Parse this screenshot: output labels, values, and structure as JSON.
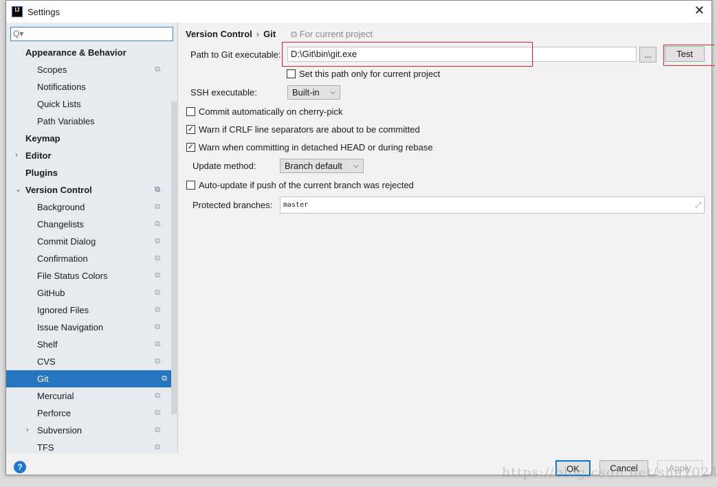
{
  "window": {
    "title": "Settings",
    "logo": "IJ"
  },
  "search": {
    "placeholder": "Q▾"
  },
  "sidebar": {
    "items": [
      {
        "label": "Appearance & Behavior",
        "level": "top"
      },
      {
        "label": "Scopes",
        "level": "sub",
        "project": true
      },
      {
        "label": "Notifications",
        "level": "sub"
      },
      {
        "label": "Quick Lists",
        "level": "sub"
      },
      {
        "label": "Path Variables",
        "level": "sub"
      },
      {
        "label": "Keymap",
        "level": "top"
      },
      {
        "label": "Editor",
        "level": "top",
        "arrow": "›"
      },
      {
        "label": "Plugins",
        "level": "top"
      },
      {
        "label": "Version Control",
        "level": "top",
        "arrow": "⌄",
        "project": true
      },
      {
        "label": "Background",
        "level": "sub",
        "project": true
      },
      {
        "label": "Changelists",
        "level": "sub",
        "project": true
      },
      {
        "label": "Commit Dialog",
        "level": "sub",
        "project": true
      },
      {
        "label": "Confirmation",
        "level": "sub",
        "project": true
      },
      {
        "label": "File Status Colors",
        "level": "sub",
        "project": true
      },
      {
        "label": "GitHub",
        "level": "sub",
        "project": true
      },
      {
        "label": "Ignored Files",
        "level": "sub",
        "project": true
      },
      {
        "label": "Issue Navigation",
        "level": "sub",
        "project": true
      },
      {
        "label": "Shelf",
        "level": "sub",
        "project": true
      },
      {
        "label": "CVS",
        "level": "sub",
        "project": true
      },
      {
        "label": "Git",
        "level": "sub",
        "project": true,
        "selected": true
      },
      {
        "label": "Mercurial",
        "level": "sub",
        "project": true
      },
      {
        "label": "Perforce",
        "level": "sub",
        "project": true
      },
      {
        "label": "Subversion",
        "level": "sub",
        "project": true,
        "arrow": "›"
      },
      {
        "label": "TFS",
        "level": "sub",
        "project": true
      }
    ]
  },
  "breadcrumb": {
    "parent": "Version Control",
    "current": "Git",
    "scope": "For current project"
  },
  "git": {
    "path_label": "Path to Git executable:",
    "path_value": "D:\\Git\\bin\\git.exe",
    "browse_label": "...",
    "test_label": "Test",
    "current_project_only": "Set this path only for current project",
    "ssh_label": "SSH executable:",
    "ssh_value": "Built-in",
    "cherry_pick": "Commit automatically on cherry-pick",
    "crlf": "Warn if CRLF line separators are about to be committed",
    "detached": "Warn when committing in detached HEAD or during rebase",
    "update_label": "Update method:",
    "update_value": "Branch default",
    "autoupdate": "Auto-update if push of the current branch was rejected",
    "protected_label": "Protected branches:",
    "protected_value": "master"
  },
  "checks": {
    "cherry_pick": false,
    "crlf": true,
    "detached": true,
    "autoupdate": false,
    "current_project_only": false
  },
  "footer": {
    "help": "?",
    "ok": "OK",
    "cancel": "Cancel",
    "apply": "Apply"
  },
  "watermark": "https://blog.csdn.net/sha1024",
  "colors": {
    "selection": "#2675bf",
    "highlight": "#e8202a"
  }
}
